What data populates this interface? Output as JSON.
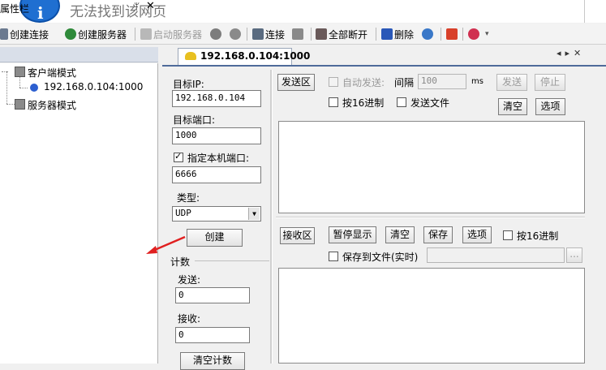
{
  "title": {
    "text": "无法找到该网页"
  },
  "toolbar": {
    "create_connection": "创建连接",
    "create_server": "创建服务器",
    "start_server": "启动服务器",
    "connect": "连接",
    "disconnect_all": "全部断开",
    "delete": "删除"
  },
  "left_panel": {
    "title": "属性栏",
    "tree": {
      "client_mode": "客户端模式",
      "connection": "192.168.0.104:1000",
      "server_mode": "服务器模式"
    }
  },
  "tab": {
    "label": "192.168.0.104:1000"
  },
  "form": {
    "target_ip_label": "目标IP:",
    "target_ip_value": "192.168.0.104",
    "target_port_label": "目标端口:",
    "target_port_value": "1000",
    "local_port_label": "指定本机端口:",
    "local_port_checked": true,
    "local_port_value": "6666",
    "type_label": "类型:",
    "type_value": "UDP",
    "create_button": "创建",
    "count_group": "计数",
    "send_label": "发送:",
    "send_count": "0",
    "recv_label": "接收:",
    "recv_count": "0",
    "clear_count_button": "清空计数"
  },
  "send_panel": {
    "title_button": "发送区",
    "auto_send": "自动发送:",
    "interval_label": "间隔",
    "interval_value": "100",
    "interval_unit": "ms",
    "send_button": "发送",
    "stop_button": "停止",
    "hex_label": "按16进制",
    "send_file_label": "发送文件",
    "clear_button": "清空",
    "options_button": "选项"
  },
  "recv_panel": {
    "title_button": "接收区",
    "pause_button": "暂停显示",
    "clear_button": "清空",
    "save_button": "保存",
    "options_button": "选项",
    "hex_label": "按16进制",
    "save_to_file_label": "保存到文件(实时)",
    "browse_button": "..."
  },
  "colors": {
    "accent": "#4f6b9a",
    "arrow": "#e02020"
  }
}
